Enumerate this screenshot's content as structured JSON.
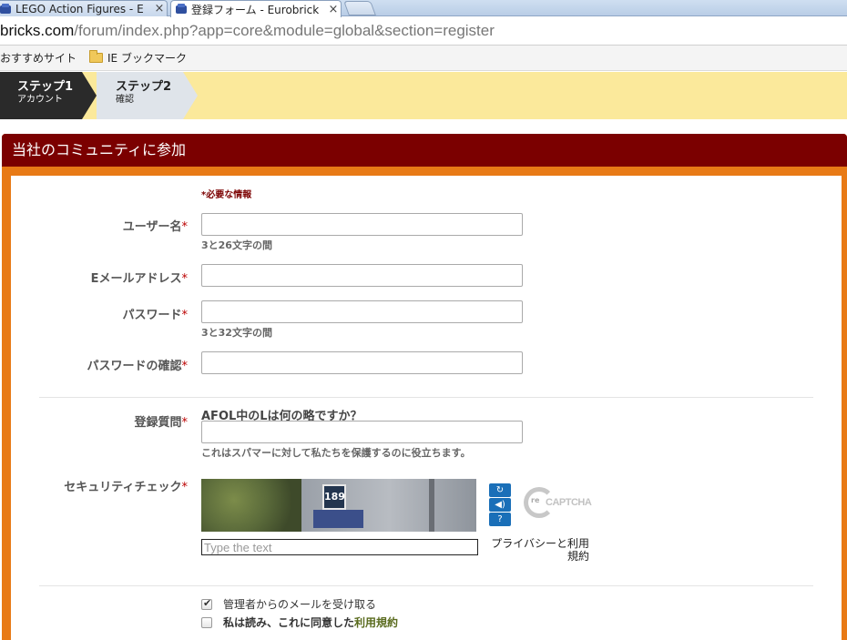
{
  "browser": {
    "tabs": [
      {
        "title": "LEGO Action Figures - E",
        "active": false
      },
      {
        "title": "登録フォーム - Eurobrick",
        "active": true
      }
    ],
    "url_host": "bricks.com",
    "url_path": "/forum/index.php?app=core&module=global&section=register",
    "bookmarks": [
      {
        "label": "おすすめサイト",
        "icon": "none"
      },
      {
        "label": "IE ブックマーク",
        "icon": "folder-icon"
      }
    ]
  },
  "steps": [
    {
      "title": "ステップ1",
      "subtitle": "アカウント",
      "active": true
    },
    {
      "title": "ステップ2",
      "subtitle": "確認",
      "active": false
    }
  ],
  "panel": {
    "header": "当社のコミュニティに参加",
    "required_note": "*必要な情報"
  },
  "form": {
    "username": {
      "label": "ユーザー名",
      "hint": "3と26文字の間",
      "value": ""
    },
    "email": {
      "label": "Eメールアドレス",
      "value": ""
    },
    "password": {
      "label": "パスワード",
      "hint": "3と32文字の間",
      "value": ""
    },
    "password_confirm": {
      "label": "パスワードの確認",
      "value": ""
    },
    "question": {
      "label": "登録質問",
      "text": "AFOL中のLは何の略ですか？",
      "hint": "これはスパマーに対して私たちを保護するのに役立ちます。",
      "value": ""
    },
    "captcha": {
      "label": "セキュリティチェック",
      "image_text": "189",
      "placeholder": "Type the text",
      "logo_text": "CAPTCHA",
      "logo_prefix": "re",
      "privacy": "プライバシーと利用規約"
    },
    "asterisk": "*"
  },
  "checks": {
    "admin_mail": {
      "label": "管理者からのメールを受け取る",
      "checked": true
    },
    "terms": {
      "prefix": "私は読み、これに同意した",
      "link": "利用規約",
      "checked": false
    }
  },
  "colors": {
    "header_bg": "#7b0000",
    "panel_border": "#e87a16",
    "step_bar_bg": "#fbe99b",
    "captcha_button": "#1a6fb8"
  }
}
